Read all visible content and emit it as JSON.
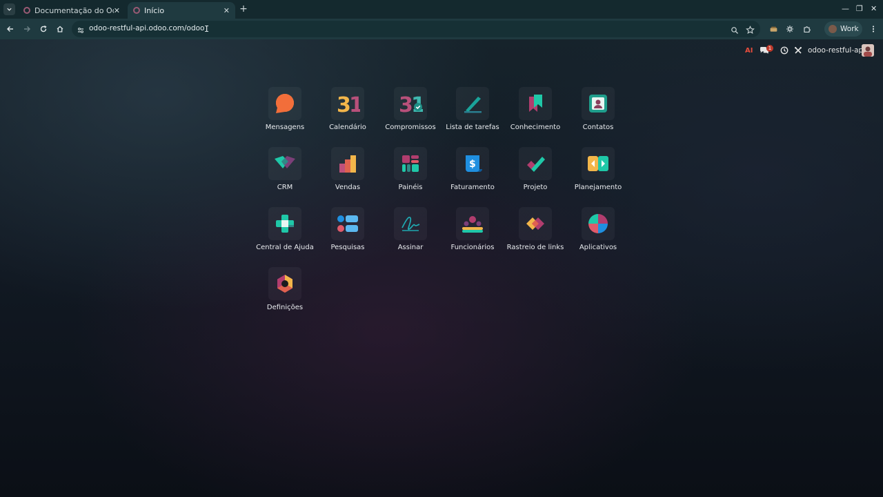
{
  "browser": {
    "tabs": [
      {
        "title": "Documentação do Odoo",
        "active": false
      },
      {
        "title": "Início",
        "active": true
      }
    ],
    "url": "odoo-restful-api.odoo.com/odoo",
    "profile_label": "Work",
    "icons": [
      "tab-search-icon",
      "back-icon",
      "forward-icon",
      "reload-icon",
      "home-icon",
      "site-info-icon",
      "zoom-icon",
      "star-icon",
      "extension-icons",
      "puzzle-icon",
      "more-icon"
    ]
  },
  "systray": {
    "ai_label": "AI",
    "messages_badge": "1",
    "db_name": "odoo-restful-api"
  },
  "apps": [
    {
      "id": "mensagens",
      "label": "Mensagens"
    },
    {
      "id": "calendario",
      "label": "Calendário",
      "glyph": "31"
    },
    {
      "id": "compromissos",
      "label": "Compromissos",
      "glyph": "31"
    },
    {
      "id": "lista-tarefas",
      "label": "Lista de tarefas"
    },
    {
      "id": "conhecimento",
      "label": "Conhecimento"
    },
    {
      "id": "contatos",
      "label": "Contatos"
    },
    {
      "id": "crm",
      "label": "CRM"
    },
    {
      "id": "vendas",
      "label": "Vendas"
    },
    {
      "id": "paineis",
      "label": "Painéis"
    },
    {
      "id": "faturamento",
      "label": "Faturamento",
      "glyph": "$"
    },
    {
      "id": "projeto",
      "label": "Projeto"
    },
    {
      "id": "planejamento",
      "label": "Planejamento"
    },
    {
      "id": "central-ajuda",
      "label": "Central de Ajuda"
    },
    {
      "id": "pesquisas",
      "label": "Pesquisas"
    },
    {
      "id": "assinar",
      "label": "Assinar"
    },
    {
      "id": "funcionarios",
      "label": "Funcionários"
    },
    {
      "id": "rastreio-links",
      "label": "Rastreio de links"
    },
    {
      "id": "aplicativos",
      "label": "Aplicativos"
    },
    {
      "id": "definicoes",
      "label": "Definições"
    }
  ]
}
